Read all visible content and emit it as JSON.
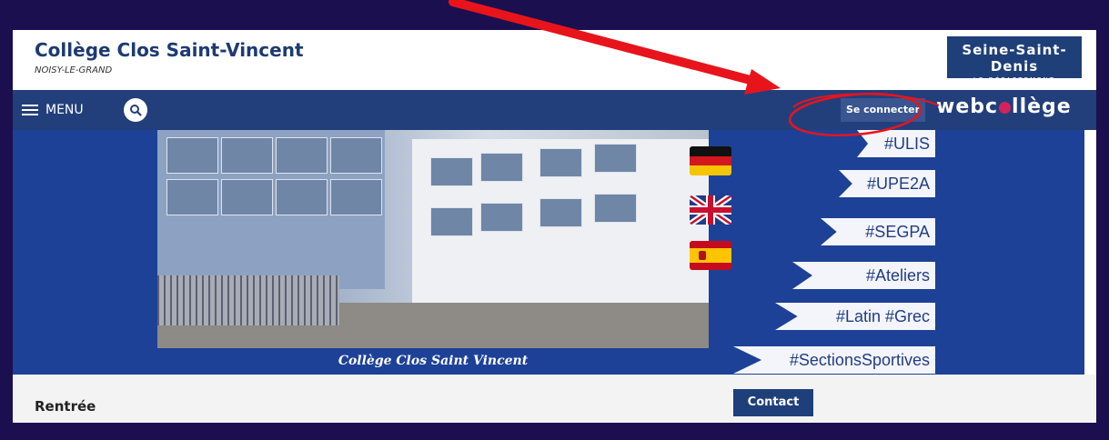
{
  "header": {
    "title": "Collège Clos Saint-Vincent",
    "subtitle": "NOISY-LE-GRAND",
    "dept_logo": {
      "name": "Seine-Saint-Denis",
      "sub": "LE DÉPARTEMENT"
    }
  },
  "navbar": {
    "menu_label": "MENU",
    "connect_label": "Se connecter",
    "brand_left": "webc",
    "brand_right": "llège"
  },
  "banner": {
    "caption": "Collège Clos Saint Vincent",
    "tags": [
      "#ULIS",
      "#UPE2A",
      "#SEGPA",
      "#Ateliers",
      "#Latin #Grec",
      "#SectionsSportives"
    ]
  },
  "content": {
    "heading": "Rentrée",
    "contact_label": "Contact"
  },
  "colors": {
    "brand_navy": "#223f7c",
    "banner_blue": "#1d4197",
    "annotation_red": "#e8141c"
  },
  "icons": [
    "hamburger-icon",
    "search-icon",
    "flag-germany-icon",
    "flag-uk-icon",
    "flag-spain-icon"
  ]
}
